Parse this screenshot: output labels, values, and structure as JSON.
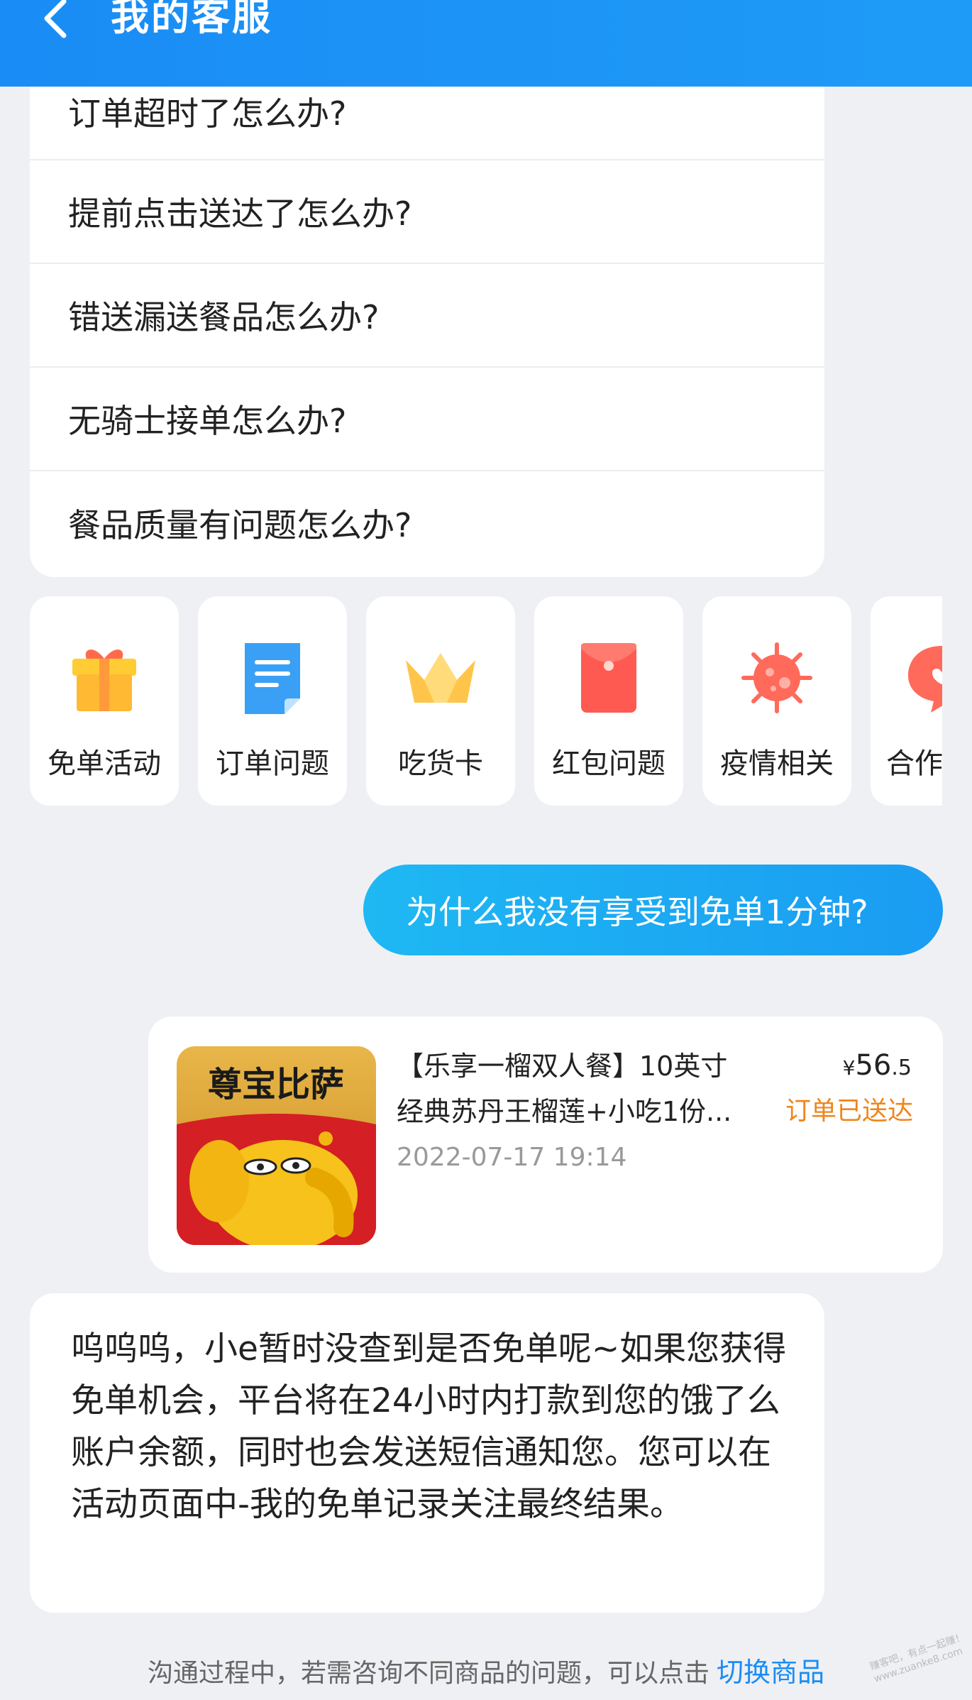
{
  "header": {
    "title": "我的客服"
  },
  "faq": [
    "订单超时了怎么办?",
    "提前点击送达了怎么办?",
    "错送漏送餐品怎么办?",
    "无骑士接单怎么办?",
    "餐品质量有问题怎么办?"
  ],
  "categories": [
    {
      "label": "免单活动",
      "icon": "gift-icon"
    },
    {
      "label": "订单问题",
      "icon": "document-icon"
    },
    {
      "label": "吃货卡",
      "icon": "crown-icon"
    },
    {
      "label": "红包问题",
      "icon": "red-envelope-icon"
    },
    {
      "label": "疫情相关",
      "icon": "virus-icon"
    },
    {
      "label": "合作",
      "icon": "chat-bubble-icon"
    }
  ],
  "user_message": "为什么我没有享受到免单1分钟?",
  "order": {
    "thumb_text": "尊宝比萨",
    "title_line1": "【乐享一榴双人餐】10英寸",
    "title_line2": "经典苏丹王榴莲+小吃1份...",
    "time": "2022-07-17 19:14",
    "price_currency": "¥",
    "price_int": "56",
    "price_dec": ".5",
    "status": "订单已送达"
  },
  "bot_message": "呜呜呜，小e暂时没查到是否免单呢~如果您获得免单机会，平台将在24小时内打款到您的饿了么账户余额，同时也会发送短信通知您。您可以在活动页面中-我的免单记录关注最终结果。",
  "footer": {
    "note": "沟通过程中，若需咨询不同商品的问题，可以点击",
    "link": "切换商品"
  },
  "watermark": {
    "line1": "赚客吧，有点一起赚！",
    "line2": "www.zuanke8.com"
  },
  "colors": {
    "header_blue": "#1a8cf5",
    "bubble_blue": "#1eb8f3",
    "status_orange": "#f0851b",
    "link_blue": "#1a8cf5"
  }
}
